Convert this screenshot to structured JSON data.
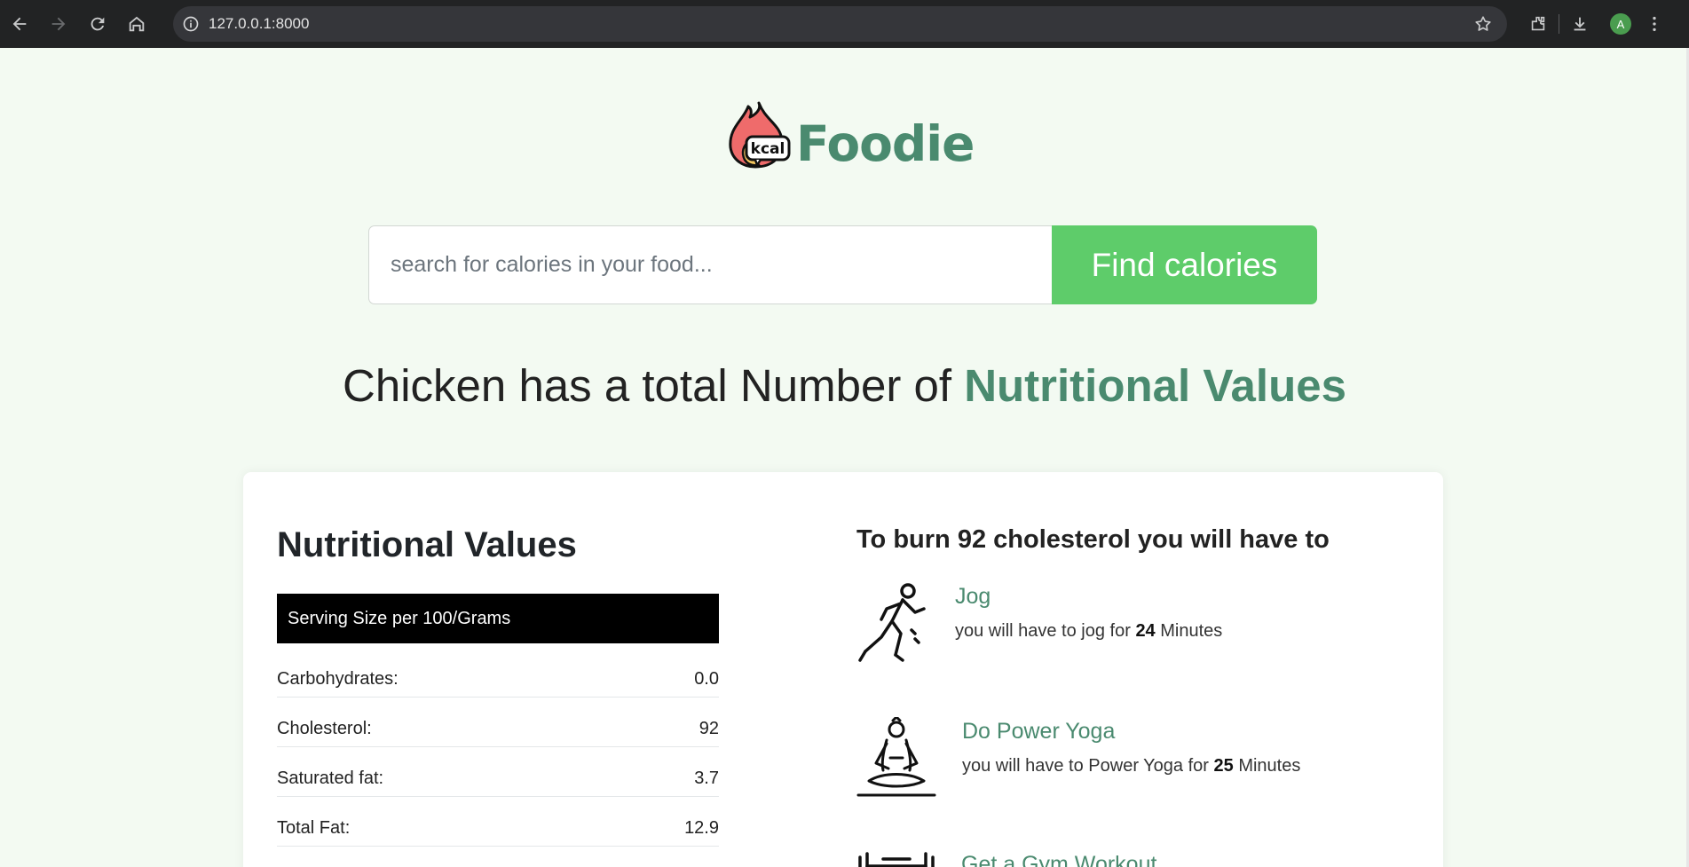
{
  "browser": {
    "url": "127.0.0.1:8000",
    "avatar_letter": "A"
  },
  "logo": {
    "badge_text": "kcal",
    "word": "Foodie"
  },
  "search": {
    "placeholder": "search for calories in your food...",
    "button_label": "Find calories"
  },
  "headline": {
    "prefix": "Chicken has a total Number of ",
    "accent": "Nutritional Values"
  },
  "nutrition": {
    "title": "Nutritional Values",
    "serving_label": "Serving Size per 100/Grams",
    "rows": [
      {
        "label": "Carbohydrates:",
        "value": "0.0"
      },
      {
        "label": "Cholesterol:",
        "value": "92"
      },
      {
        "label": "Saturated fat:",
        "value": "3.7"
      },
      {
        "label": "Total Fat:",
        "value": "12.9"
      }
    ]
  },
  "burn": {
    "title": "To burn 92 cholesterol you will have to",
    "exercises": [
      {
        "name": "Jog",
        "desc_prefix": "you will have to jog for ",
        "minutes": "24",
        "desc_suffix": " Minutes",
        "icon": "jogging-icon"
      },
      {
        "name": "Do Power Yoga",
        "desc_prefix": "you will have to Power Yoga for ",
        "minutes": "25",
        "desc_suffix": " Minutes",
        "icon": "yoga-icon"
      },
      {
        "name": "Get a Gym Workout",
        "icon": "gym-icon"
      }
    ]
  },
  "colors": {
    "brand_green": "#4a8a6f",
    "button_green": "#5ecc6a",
    "page_bg": "#f3faf2"
  }
}
